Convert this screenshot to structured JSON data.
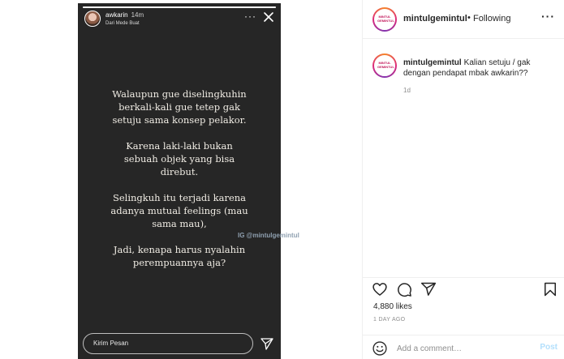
{
  "story": {
    "username": "awkarin",
    "time": "14m",
    "subtitle": "Dari Mede Buat",
    "more_label": "···",
    "progress": 1.0,
    "paragraphs": [
      "Walaupun gue diselingkuhin\nberkali-kali gue tetep gak\nsetuju sama konsep pelakor.",
      "Karena laki-laki bukan\nsebuah objek yang bisa\ndirebut.",
      "Selingkuh itu terjadi karena\nadanya mutual feelings (mau\nsama mau),",
      "Jadi, kenapa harus nyalahin\nperempuannya aja?"
    ],
    "reply_placeholder": "Kirim Pesan",
    "icons": {
      "close": "close-icon",
      "send": "send-icon"
    }
  },
  "watermark": "IG @mintulgemintul",
  "post": {
    "username": "mintulgemintul",
    "separator": "•",
    "follow_status": "Following",
    "more_label": "···",
    "avatar_text": "MINTUL GEMINTUL",
    "caption_user": "mintulgemintul",
    "caption_text": "Kalian setuju / gak dengan pendapat mbak awkarin??",
    "caption_time": "1d",
    "likes": "4,880 likes",
    "date": "1 DAY AGO",
    "comment_placeholder": "Add a comment…",
    "post_label": "Post",
    "icons": {
      "like": "heart-icon",
      "comment": "comment-icon",
      "share": "share-icon",
      "save": "bookmark-icon",
      "emoji": "emoji-icon"
    }
  },
  "colors": {
    "story_bg": "#262626",
    "post_button_disabled": "#b2dffc",
    "muted_text": "#8e8e8e",
    "story_ring_start": "#f58529",
    "story_ring_mid": "#dd2a7b"
  }
}
